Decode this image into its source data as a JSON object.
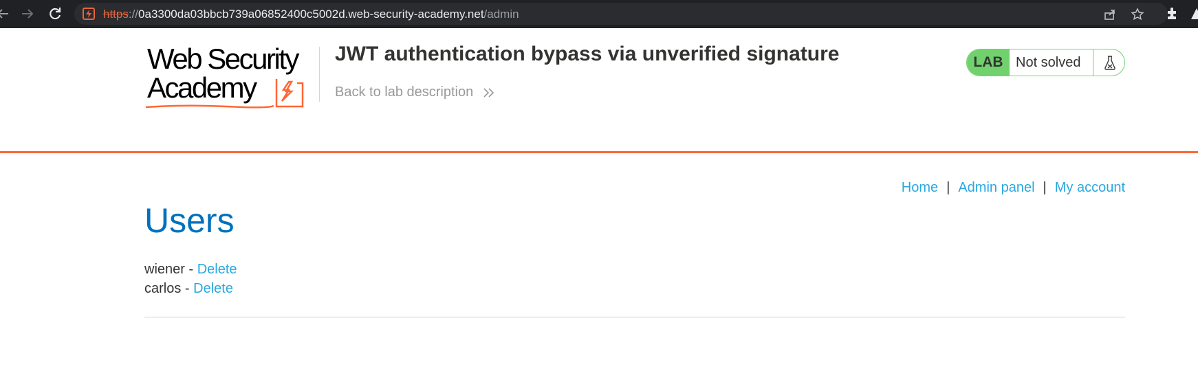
{
  "browser": {
    "url_scheme": "https",
    "url_separator": "://",
    "url_host": "0a3300da03bbcb739a06852400c5002d.web-security-academy.net",
    "url_path": "/admin"
  },
  "logo": {
    "line1": "Web Security",
    "line2": "Academy",
    "accent_color": "#ff6633"
  },
  "lab": {
    "title": "JWT authentication bypass via unverified signature",
    "back_link": "Back to lab description",
    "badge": "LAB",
    "status": "Not solved",
    "status_color": "#70d16d"
  },
  "nav": {
    "home": "Home",
    "separator": "|",
    "admin_panel": "Admin panel",
    "my_account": "My account"
  },
  "main": {
    "heading": "Users",
    "users": [
      {
        "name": "wiener",
        "separator": " - ",
        "action": "Delete"
      },
      {
        "name": "carlos",
        "separator": " - ",
        "action": "Delete"
      }
    ]
  }
}
